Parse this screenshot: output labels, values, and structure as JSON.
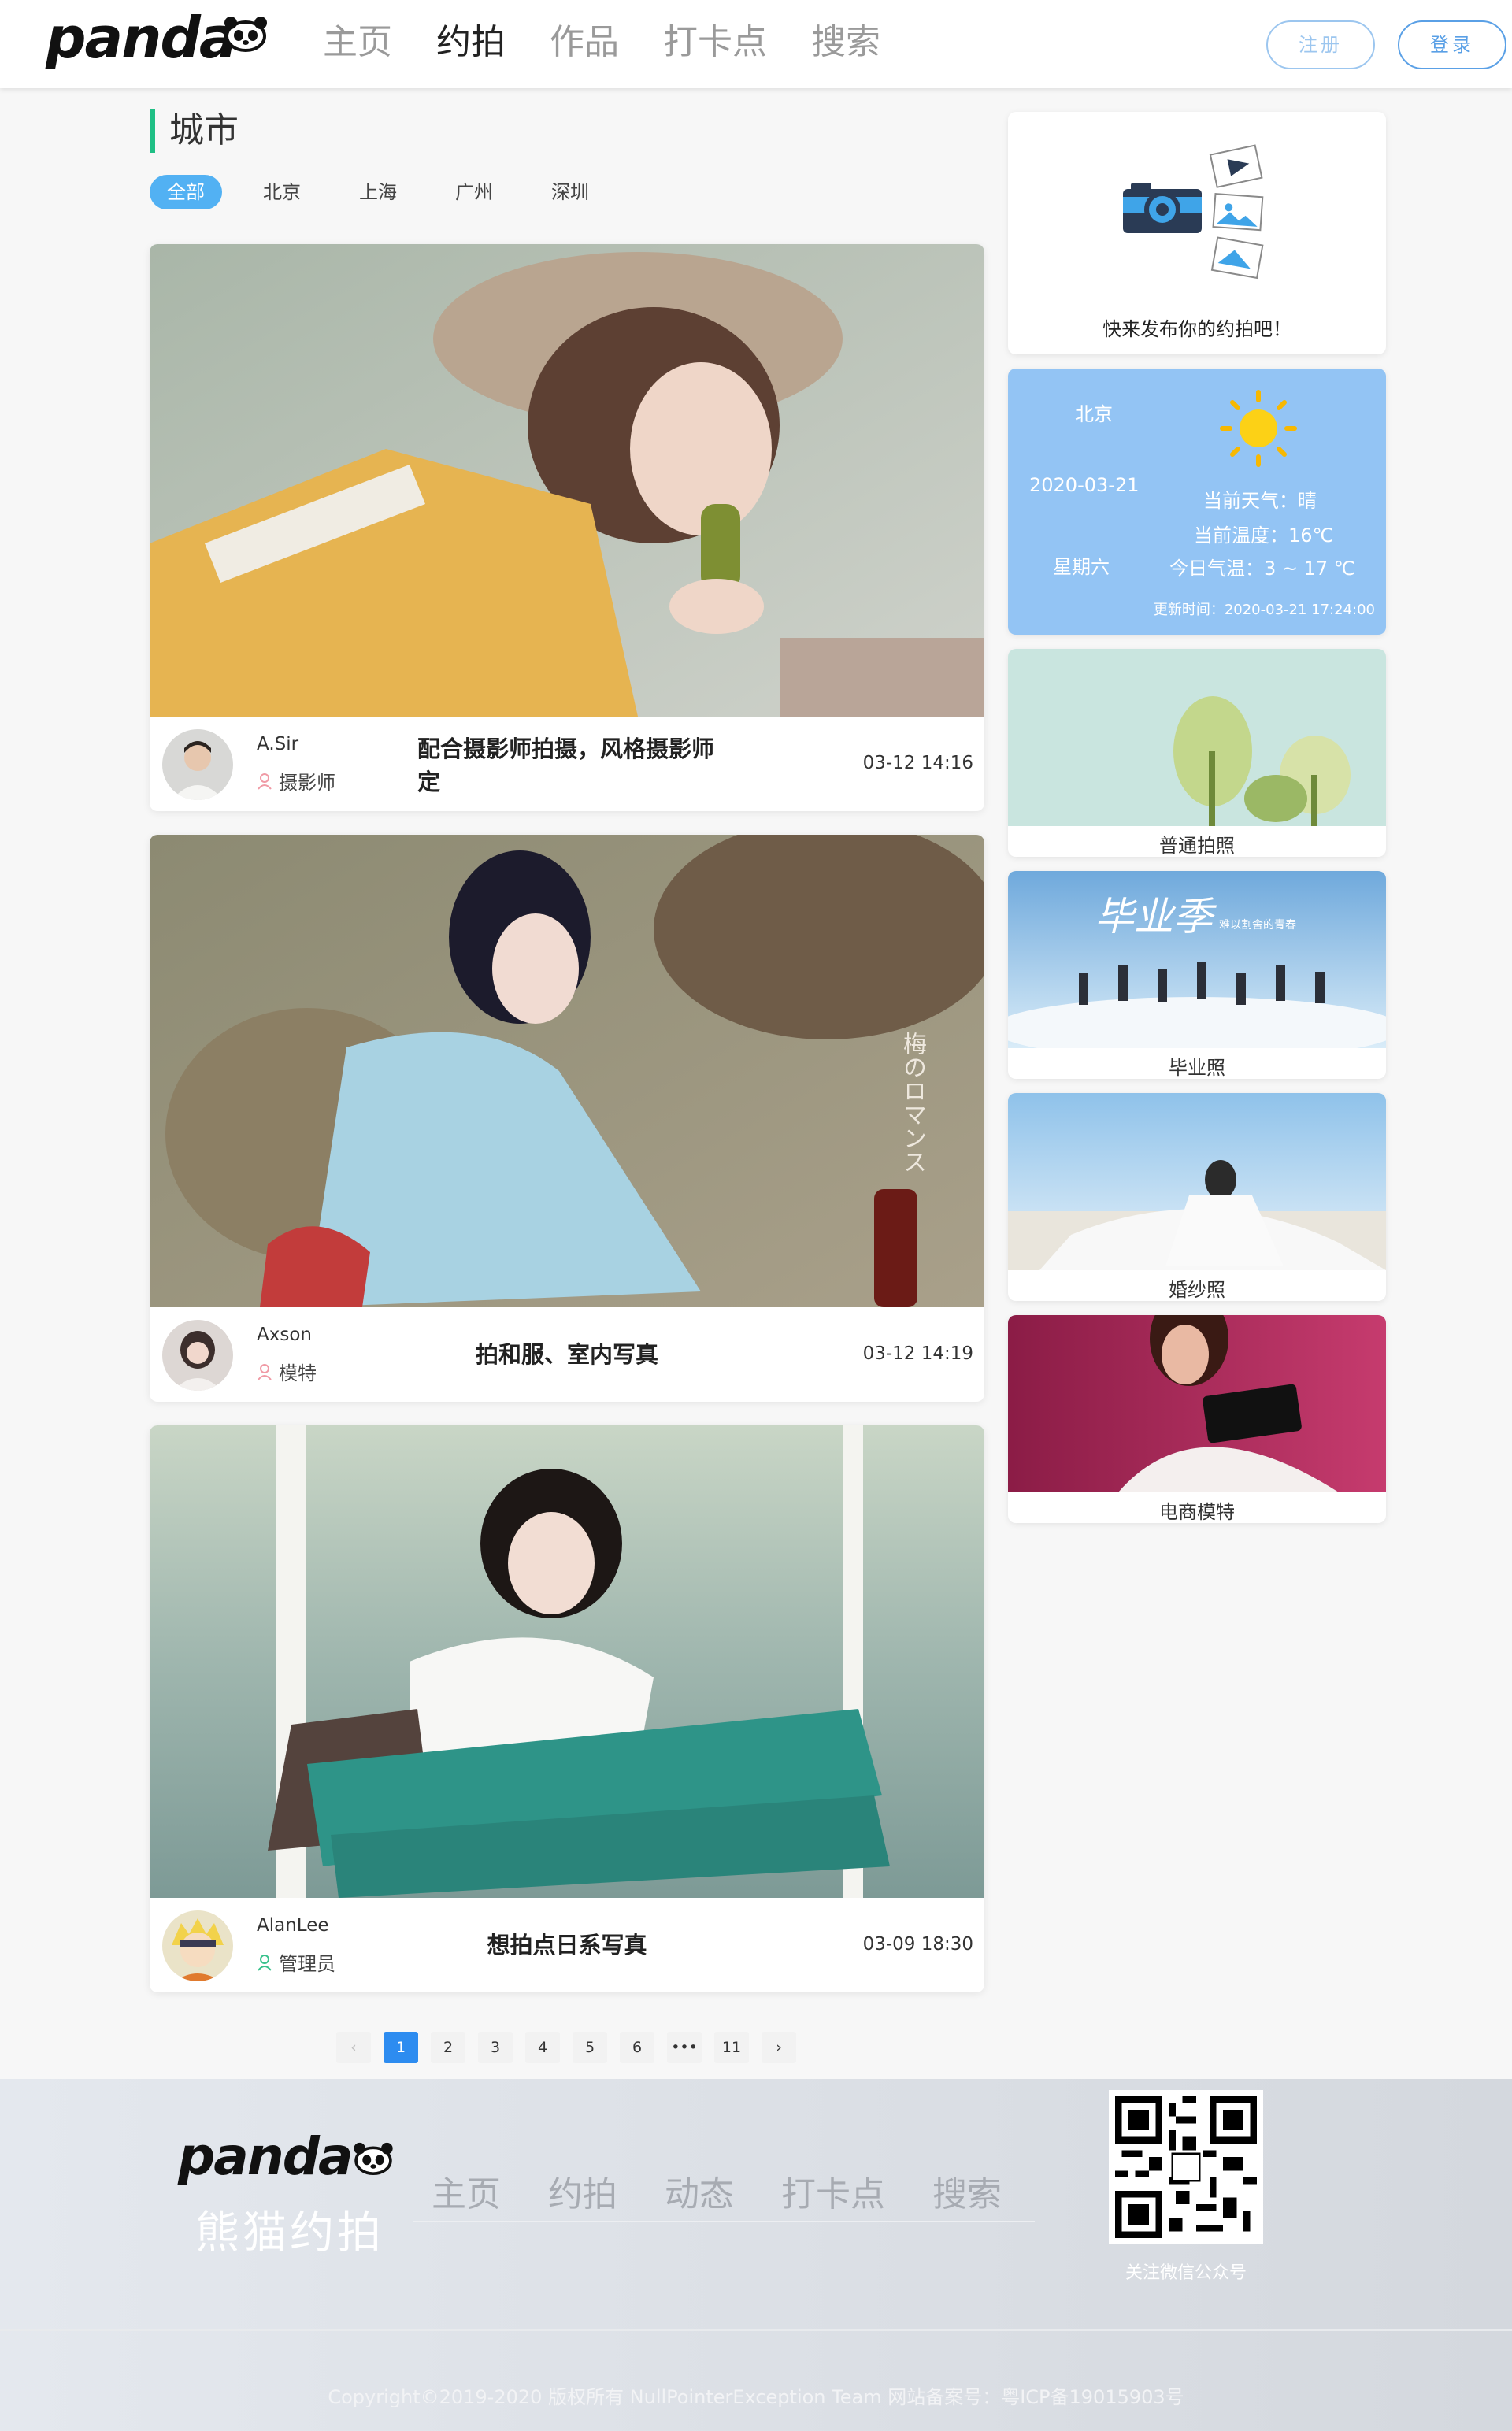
{
  "header": {
    "logo": "panda",
    "nav": [
      "主页",
      "约拍",
      "作品",
      "打卡点",
      "搜索"
    ],
    "active_nav": "约拍",
    "register_label": "注册",
    "login_label": "登录"
  },
  "city": {
    "title": "城市",
    "filters": [
      "全部",
      "北京",
      "上海",
      "广州",
      "深圳"
    ],
    "active_filter": "全部"
  },
  "posts": [
    {
      "user": "A.Sir",
      "role": "摄影师",
      "title": "配合摄影师拍摄，风格摄影师定",
      "date": "03-12 14:16"
    },
    {
      "user": "Axson",
      "role": "模特",
      "title": "拍和服、室内写真",
      "date": "03-12 14:19",
      "image_text": "梅のロマンス"
    },
    {
      "user": "AlanLee",
      "role": "管理员",
      "title": "想拍点日系写真",
      "date": "03-09 18:30"
    }
  ],
  "sidebar": {
    "publish_text": "快来发布你的约拍吧！",
    "weather": {
      "city": "北京",
      "date": "2020-03-21",
      "weekday": "星期六",
      "condition": "当前天气：晴",
      "temp": "当前温度：16℃",
      "range": "今日气温：3 ~ 17 ℃",
      "updated": "更新时间：2020-03-21 17:24:00"
    },
    "categories": [
      "普通拍照",
      "毕业照",
      "婚纱照",
      "电商模特"
    ],
    "graduation_banner_text": "毕业季",
    "graduation_banner_sub": "难以割舍的青春"
  },
  "pagination": {
    "pages": [
      "1",
      "2",
      "3",
      "4",
      "5",
      "6",
      "•••",
      "11"
    ],
    "current": "1",
    "prev": "‹",
    "next": "›"
  },
  "footer": {
    "logo": "panda",
    "name_cn": "熊猫约拍",
    "nav": [
      "主页",
      "约拍",
      "动态",
      "打卡点",
      "搜索"
    ],
    "qr_label": "关注微信公众号",
    "copyright": "Copyright©2019-2020 版权所有 NullPointerException Team 网站备案号：粤ICP备19015903号"
  },
  "colors": {
    "accent": "#2d8cf0",
    "green_bar": "#1fbf85",
    "weather_bg": "#93c4f4",
    "filter_active": "#52b1f3"
  }
}
